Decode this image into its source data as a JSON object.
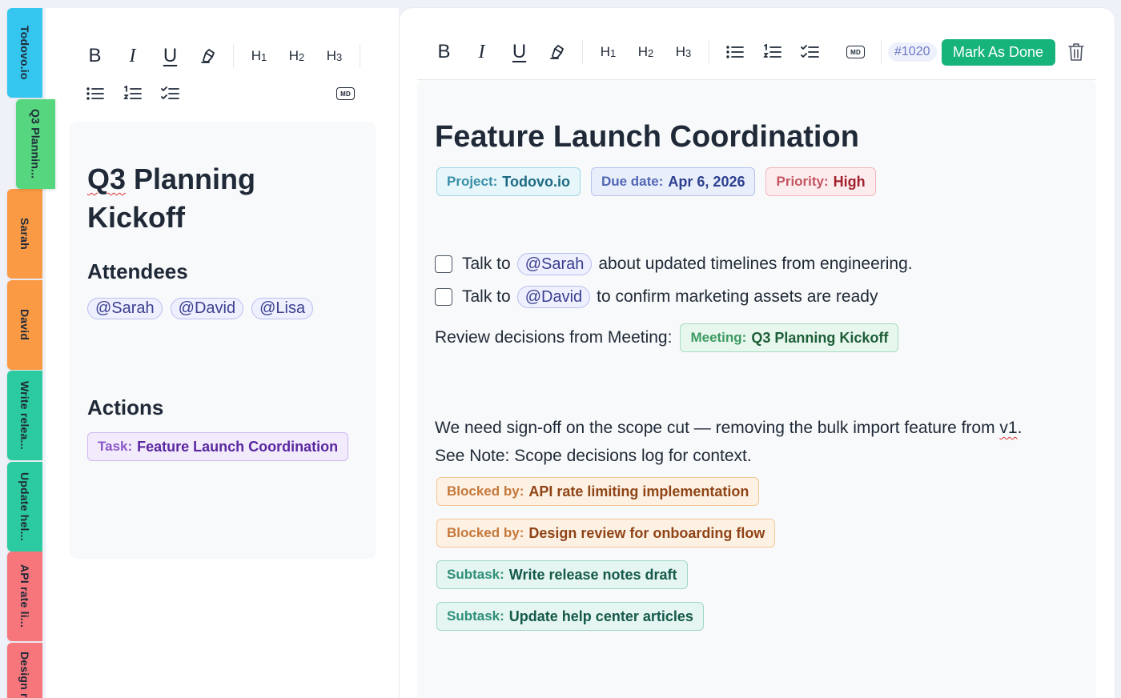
{
  "tabs": [
    {
      "label": "Todovo.io",
      "color": "#34c6ee"
    },
    {
      "label": "Q3 Plannin...",
      "color": "#56d67e",
      "active": true
    },
    {
      "label": "Sarah",
      "color": "#fb9a45"
    },
    {
      "label": "David",
      "color": "#fb9a45"
    },
    {
      "label": "Write relea...",
      "color": "#2ccaa0"
    },
    {
      "label": "Update hel...",
      "color": "#2ccaa0"
    },
    {
      "label": "API rate li...",
      "color": "#f7767c"
    },
    {
      "label": "Design r",
      "color": "#f7767c"
    }
  ],
  "left": {
    "title_word1": "Q3",
    "title_rest": " Planning Kickoff",
    "attendees_heading": "Attendees",
    "attendees": [
      "@Sarah",
      "@David",
      "@Lisa"
    ],
    "actions_heading": "Actions",
    "task_key": "Task:",
    "task_value": "Feature Launch Coordination"
  },
  "toolbar": {
    "bold": "B",
    "italic": "I",
    "underline": "U",
    "h1": "H",
    "h1_sub": "1",
    "h2": "H",
    "h2_sub": "2",
    "h3": "H",
    "h3_sub": "3",
    "md": "MD"
  },
  "right": {
    "ticket": "#1020",
    "done_label": "Mark As Done",
    "title": "Feature Launch Coordination",
    "meta": [
      {
        "key": "Project:",
        "value": "Todovo.io",
        "bg": "#e6f6fa",
        "border": "#9fd8e6",
        "kcolor": "#3a8ea8",
        "vcolor": "#1e6b83"
      },
      {
        "key": "Due date:",
        "value": "Apr 6, 2026",
        "bg": "#e9eefb",
        "border": "#b5c3ee",
        "kcolor": "#5266b4",
        "vcolor": "#2d3f8f"
      },
      {
        "key": "Priority:",
        "value": "High",
        "bg": "#fdecee",
        "border": "#f3b6bc",
        "kcolor": "#c25560",
        "vcolor": "#a1232f"
      }
    ],
    "todo1": {
      "pre": "Talk to",
      "mention": "@Sarah",
      "post": "about updated timelines from engineering."
    },
    "todo2": {
      "pre": "Talk to",
      "mention": "@David",
      "post": "to confirm marketing assets are ready"
    },
    "review_text": "Review decisions from Meeting:",
    "meeting_key": "Meeting:",
    "meeting_value": "Q3 Planning Kickoff",
    "para1_main": "We need sign-off on the scope cut — removing the bulk import feature from ",
    "para1_spell": "v1",
    "para1_end": ".",
    "para2": "See Note: Scope decisions log for context.",
    "links": [
      {
        "key": "Blocked by:",
        "value": "API rate limiting implementation",
        "kind": "blocked"
      },
      {
        "key": "Blocked by:",
        "value": "Design review for onboarding flow",
        "kind": "blocked"
      },
      {
        "key": "Subtask:",
        "value": "Write release notes draft",
        "kind": "subtask"
      },
      {
        "key": "Subtask:",
        "value": "Update help center articles",
        "kind": "subtask"
      }
    ]
  },
  "colors": {
    "accent_green": "#16b47a",
    "blocked_bg": "#fdf1e4",
    "blocked_border": "#f3c796",
    "blocked_key": "#c5783b",
    "blocked_value": "#8f4416",
    "subtask_bg": "#e5f5f1",
    "subtask_border": "#9fd6c8",
    "subtask_key": "#2d8f78",
    "subtask_value": "#14594a",
    "meeting_bg": "#e8f7ee",
    "meeting_border": "#a7dcbc",
    "meeting_key": "#3d9a62",
    "meeting_value": "#1d5e37",
    "task_bg": "#f2ebfb",
    "task_border": "#cdb7ef",
    "task_key": "#8a55c9",
    "task_value": "#5a27a0"
  }
}
